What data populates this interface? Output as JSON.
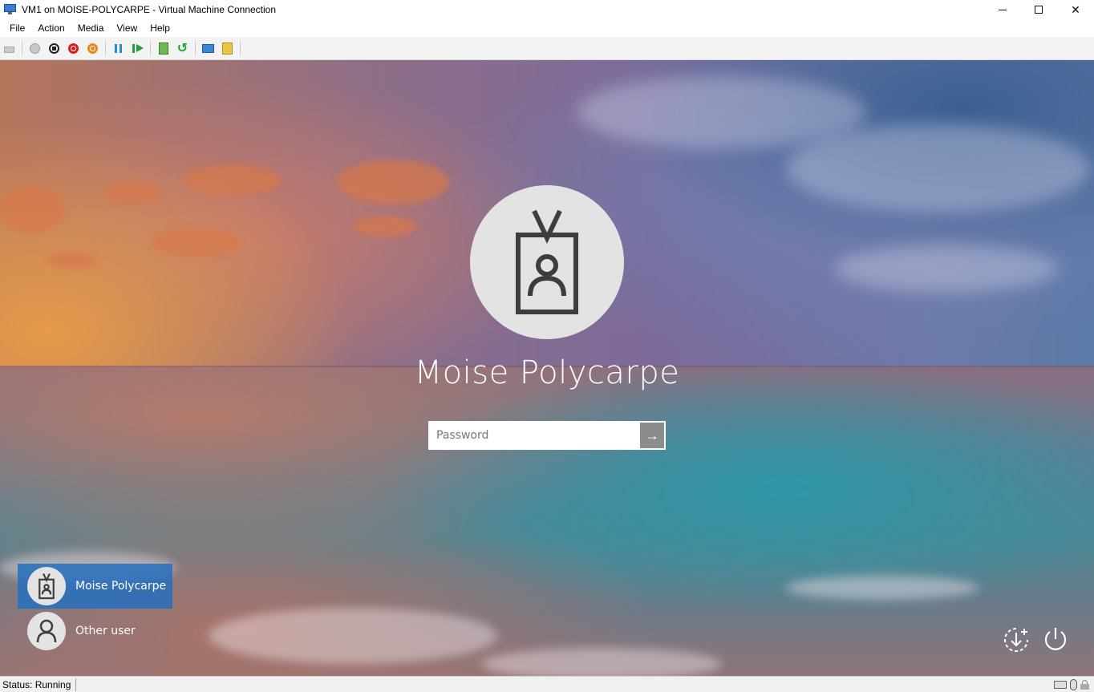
{
  "window": {
    "title": "VM1 on MOISE-POLYCARPE - Virtual Machine Connection",
    "close_glyph": "✕"
  },
  "menu": {
    "items": [
      "File",
      "Action",
      "Media",
      "View",
      "Help"
    ]
  },
  "toolbar": {
    "buttons": [
      "ctrl-alt-del",
      "start",
      "turn-off",
      "shut-down",
      "save",
      "pause",
      "reset",
      "checkpoint",
      "revert",
      "enhanced-session",
      "share"
    ],
    "revert_glyph": "↺"
  },
  "login": {
    "user_name": "Moise Polycarpe",
    "password_placeholder": "Password",
    "password_value": "",
    "submit_glyph": "→"
  },
  "user_list": [
    {
      "label": "Moise Polycarpe",
      "icon": "badge-user-icon",
      "selected": true
    },
    {
      "label": "Other user",
      "icon": "person-icon",
      "selected": false
    }
  ],
  "status": {
    "text": "Status: Running"
  },
  "colors": {
    "selection_blue": "#266ebe",
    "avatar_bg": "#e3e3e3",
    "icon_dark": "#3d3d3d"
  }
}
